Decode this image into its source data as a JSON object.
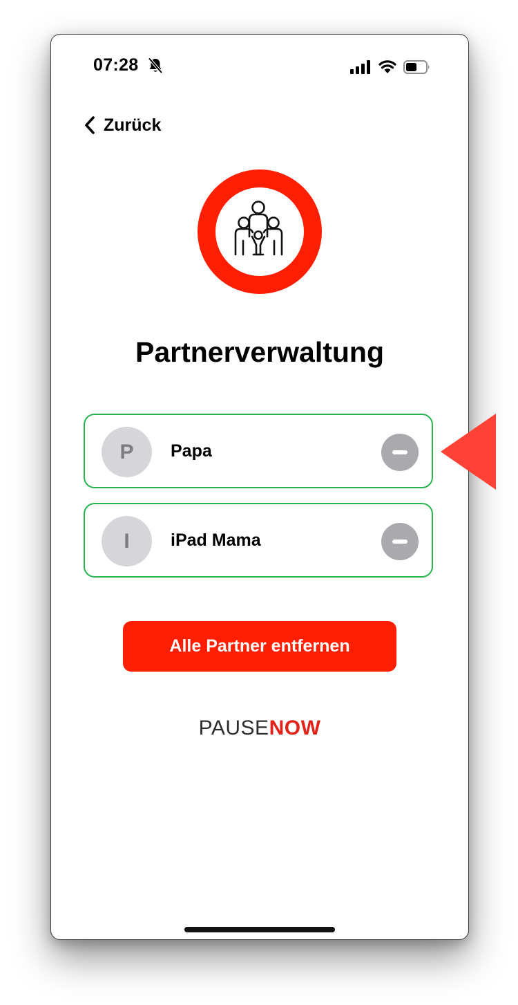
{
  "status_bar": {
    "time": "07:28",
    "icons": [
      "bell-slash-icon",
      "cellular-signal-icon",
      "wifi-icon",
      "battery-icon"
    ]
  },
  "nav": {
    "back_label": "Zurück",
    "back_icon": "chevron-left-icon"
  },
  "header": {
    "logo_icon": "family-icon",
    "title": "Partnerverwaltung"
  },
  "partners": [
    {
      "initial": "P",
      "name": "Papa",
      "action_icon": "minus-icon"
    },
    {
      "initial": "I",
      "name": "iPad Mama",
      "action_icon": "minus-icon"
    }
  ],
  "actions": {
    "remove_all_label": "Alle Partner entfernen"
  },
  "brand": {
    "part1": "PAUSE",
    "part2": "NOW"
  },
  "colors": {
    "accent_red": "#ff1f00",
    "card_border_green": "#28b44f",
    "avatar_gray": "#d6d6da",
    "remove_button_gray": "#a9a9ae",
    "annotation_arrow_red": "#ff4136"
  }
}
